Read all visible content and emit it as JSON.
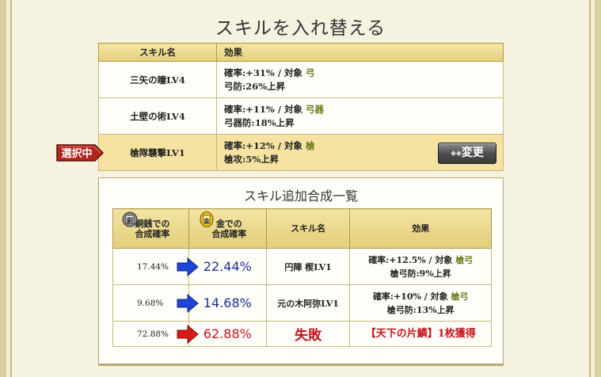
{
  "title": "スキルを入れ替える",
  "skills_table": {
    "header_name": "スキル名",
    "header_effect": "効果",
    "rows": [
      {
        "name": "三矢の瞳LV4",
        "line1_prefix": "確率:+31% / 対象 ",
        "target": "弓",
        "line2": "弓防:26%上昇"
      },
      {
        "name": "土壁の術LV4",
        "line1_prefix": "確率:+11% / 対象 ",
        "target": "弓器",
        "line2": "弓器防:18%上昇"
      },
      {
        "name": "槍隊襲撃LV1",
        "line1_prefix": "確率:+12% / 対象 ",
        "target": "槍",
        "line2": "槍攻:5%上昇"
      }
    ],
    "selected_badge": "選択中",
    "change_button": "変更"
  },
  "synthesis": {
    "title": "スキル追加合成一覧",
    "headers": {
      "copper_line1": "銅銭での",
      "copper_line2": "合成確率",
      "gold_line1": "金での",
      "gold_line2": "合成確率",
      "skill_name": "スキル名",
      "effect": "効果"
    },
    "coin_labels": {
      "copper": "銅",
      "gold": "金"
    },
    "rows": [
      {
        "copper_rate": "17.44%",
        "gold_rate": "22.44%",
        "skill": "円陣 楔LV1",
        "eff_prefix": "確率:+12.5% / 対象 ",
        "eff_target": "槍弓",
        "eff_line2": "槍弓防:9%上昇"
      },
      {
        "copper_rate": "9.68%",
        "gold_rate": "14.68%",
        "skill": "元の木阿弥LV1",
        "eff_prefix": "確率:+10% / 対象 ",
        "eff_target": "槍弓",
        "eff_line2": "槍弓防:13%上昇"
      },
      {
        "copper_rate": "72.88%",
        "gold_rate": "62.88%",
        "skill": "失敗",
        "eff_text": "【天下の片鱗】1枚獲得"
      }
    ]
  },
  "colors": {
    "arrow_blue": "#1e46d6",
    "arrow_red": "#d51a1a",
    "badge_red": "#b3261e",
    "olive": "#6d7a1e"
  }
}
